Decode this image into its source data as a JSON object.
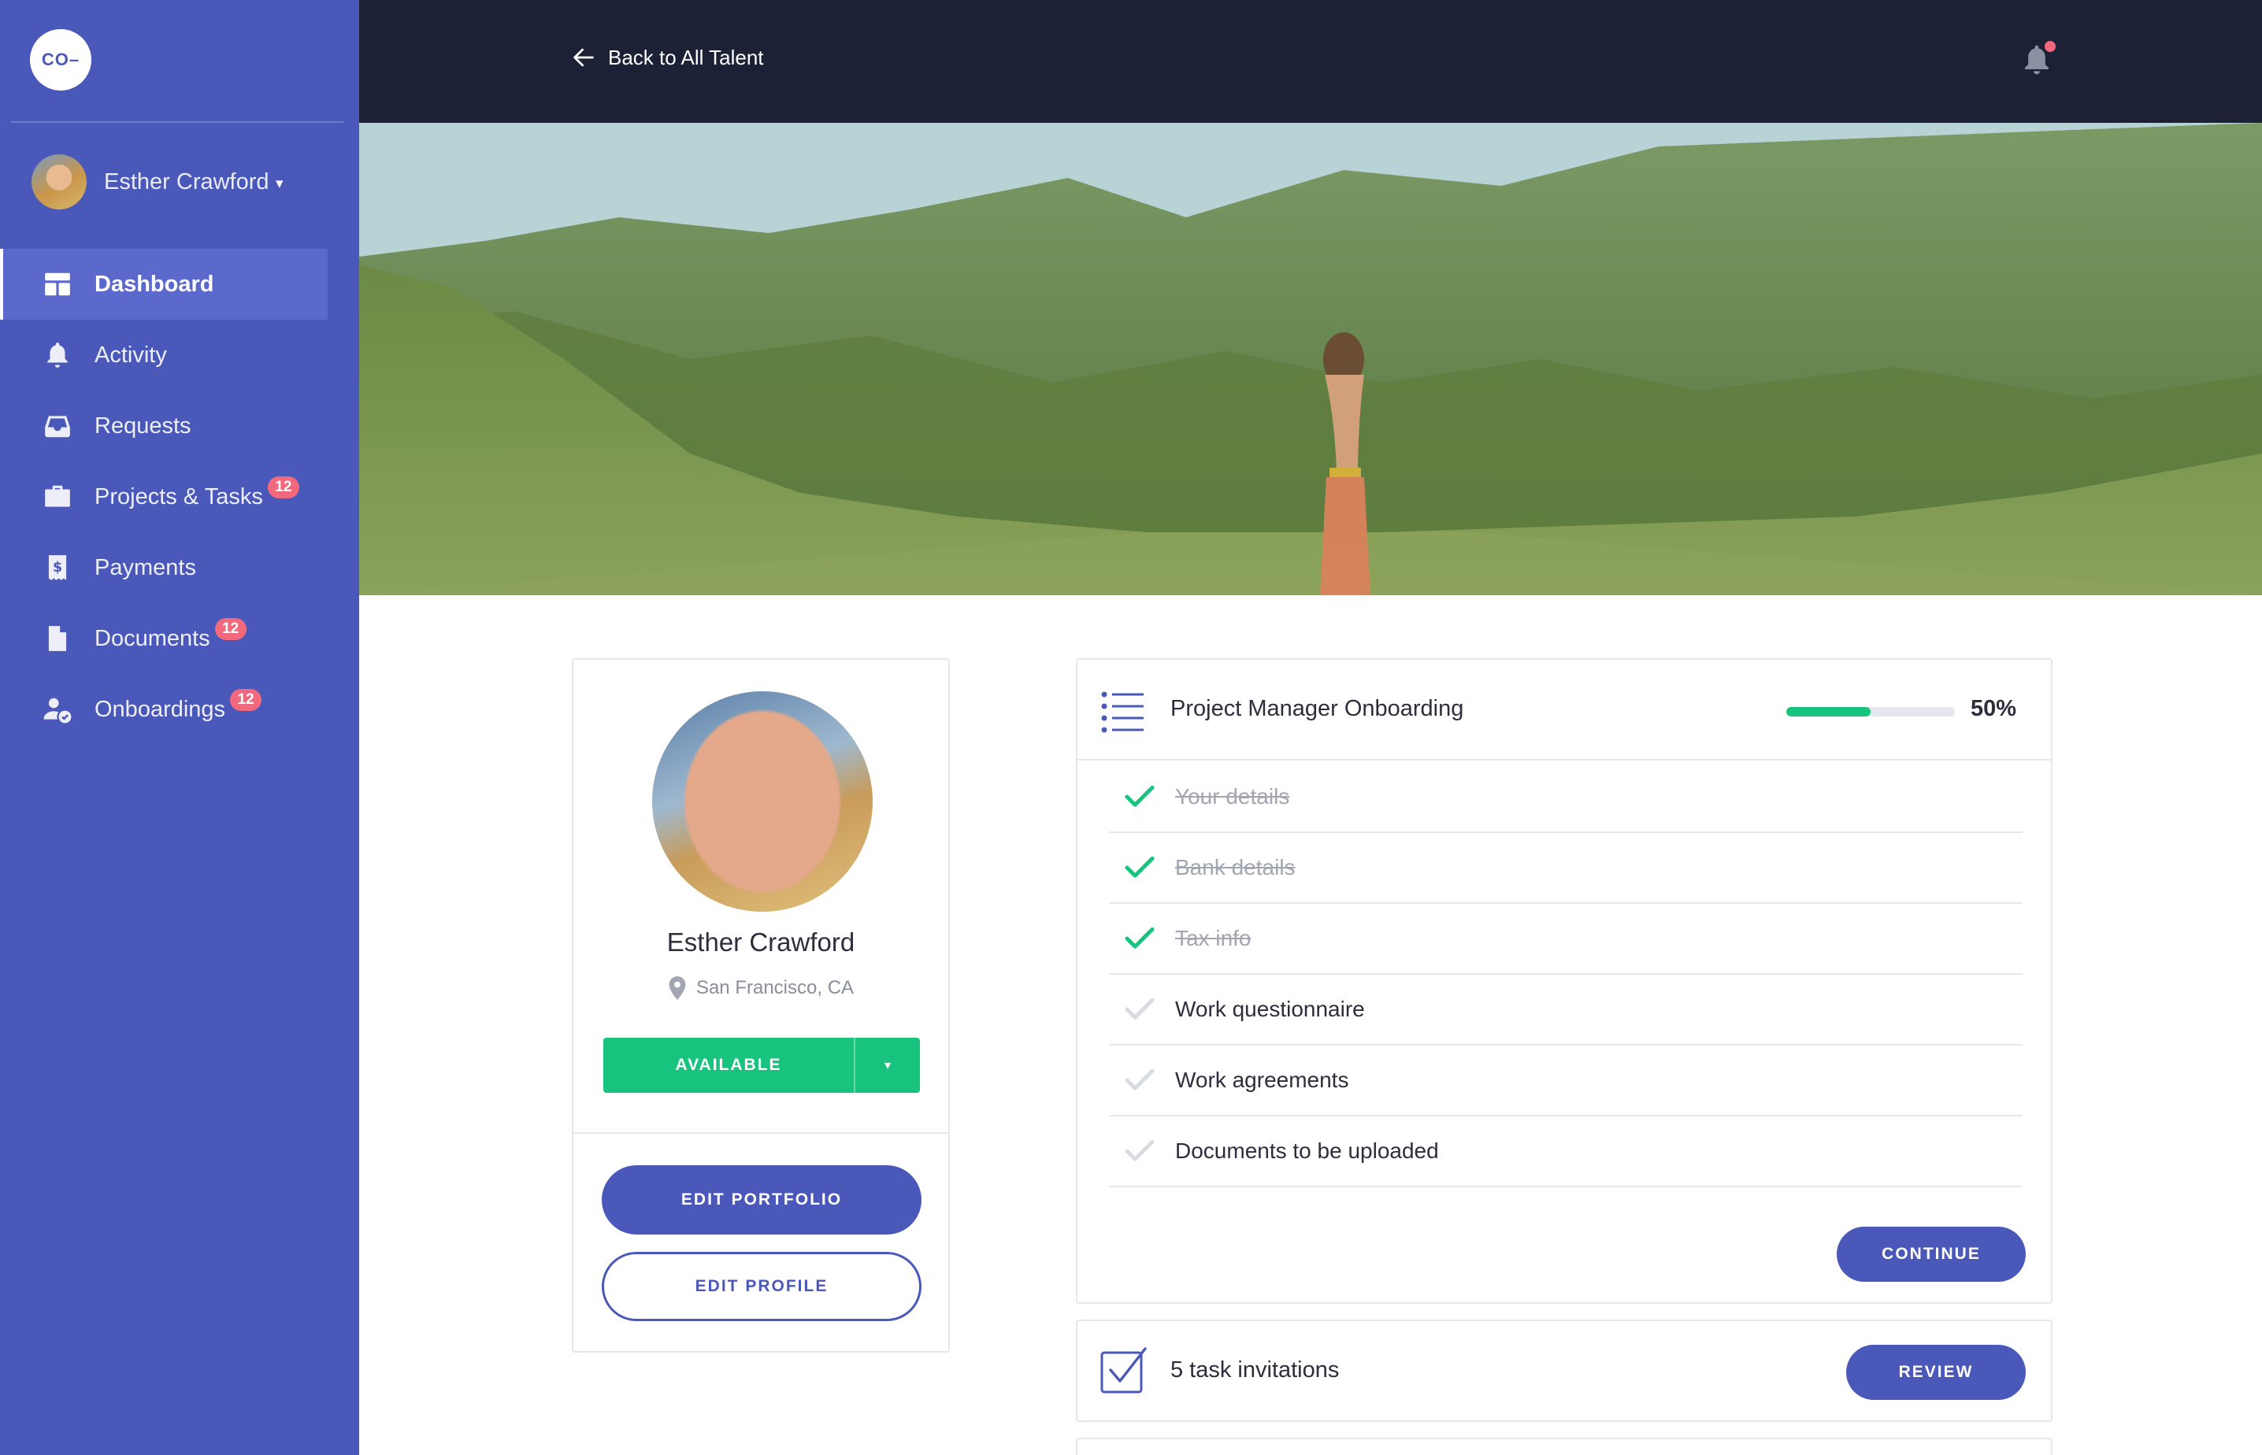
{
  "brand": {
    "logo_text": "CO–",
    "accent": "#4a58b9",
    "success": "#18c37e",
    "badge": "#f2697e",
    "topbar": "#1c2135"
  },
  "sidebar": {
    "user": {
      "name": "Esther Crawford",
      "caret": "▾"
    },
    "items": [
      {
        "label": "Dashboard",
        "icon": "dashboard-icon",
        "active": true,
        "badge": ""
      },
      {
        "label": "Activity",
        "icon": "bell-icon",
        "active": false,
        "badge": ""
      },
      {
        "label": "Requests",
        "icon": "inbox-icon",
        "active": false,
        "badge": ""
      },
      {
        "label": "Projects & Tasks",
        "icon": "briefcase-icon",
        "active": false,
        "badge": "12"
      },
      {
        "label": "Payments",
        "icon": "dollar-doc-icon",
        "active": false,
        "badge": ""
      },
      {
        "label": "Documents",
        "icon": "document-icon",
        "active": false,
        "badge": "12"
      },
      {
        "label": "Onboardings",
        "icon": "user-check-icon",
        "active": false,
        "badge": "12"
      }
    ]
  },
  "topbar": {
    "back_label": "Back to All Talent"
  },
  "profile": {
    "name": "Esther Crawford",
    "location": "San Francisco, CA",
    "status": "AVAILABLE",
    "status_caret": "▾",
    "edit_portfolio": "EDIT PORTFOLIO",
    "edit_profile": "EDIT PROFILE"
  },
  "onboarding": {
    "title": "Project Manager Onboarding",
    "progress": 0.5,
    "progress_label": "50%",
    "steps": [
      {
        "label": "Your details",
        "done": true
      },
      {
        "label": "Bank details",
        "done": true
      },
      {
        "label": "Tax info",
        "done": true
      },
      {
        "label": "Work questionnaire",
        "done": false
      },
      {
        "label": "Work agreements",
        "done": false
      },
      {
        "label": "Documents to be uploaded",
        "done": false
      }
    ],
    "continue_label": "CONTINUE"
  },
  "tasks": {
    "label": "5 task invitations",
    "review_label": "REVIEW"
  }
}
